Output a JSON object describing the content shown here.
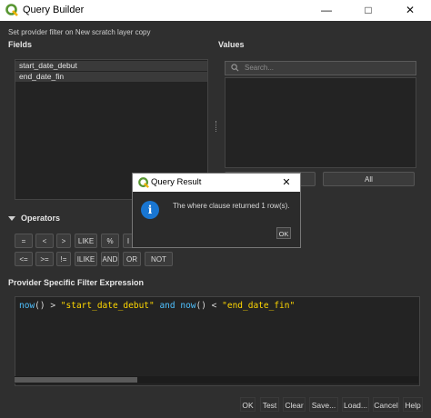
{
  "window": {
    "title": "Query Builder",
    "subtitle": "Set provider filter on New scratch layer copy"
  },
  "fields": {
    "heading": "Fields",
    "items": [
      "start_date_debut",
      "end_date_fin"
    ]
  },
  "values": {
    "heading": "Values",
    "search_placeholder": "Search...",
    "all_label": "All"
  },
  "operators": {
    "heading": "Operators",
    "row1": [
      "=",
      "<",
      ">",
      "LIKE",
      "%",
      "I"
    ],
    "row2": [
      "<=",
      ">=",
      "!=",
      "ILIKE",
      "AND",
      "OR",
      "NOT"
    ]
  },
  "expression": {
    "heading": "Provider Specific Filter Expression",
    "tokens": [
      {
        "text": "now",
        "color": "#4fc1ff"
      },
      {
        "text": "() > ",
        "color": "#dcdcdc"
      },
      {
        "text": "\"start_date_debut\"",
        "color": "#ffd700"
      },
      {
        "text": " and ",
        "color": "#4fc1ff"
      },
      {
        "text": "now",
        "color": "#4fc1ff"
      },
      {
        "text": "() < ",
        "color": "#dcdcdc"
      },
      {
        "text": "\"end_date_fin\"",
        "color": "#ffd700"
      }
    ]
  },
  "buttons": [
    "OK",
    "Test",
    "Clear",
    "Save...",
    "Load...",
    "Cancel",
    "Help"
  ],
  "dialog": {
    "title": "Query Result",
    "message": "The where clause returned 1 row(s).",
    "ok_label": "OK",
    "icon": "i"
  },
  "colors": {
    "qgis_green": "#589632",
    "info_blue": "#1976d2"
  }
}
